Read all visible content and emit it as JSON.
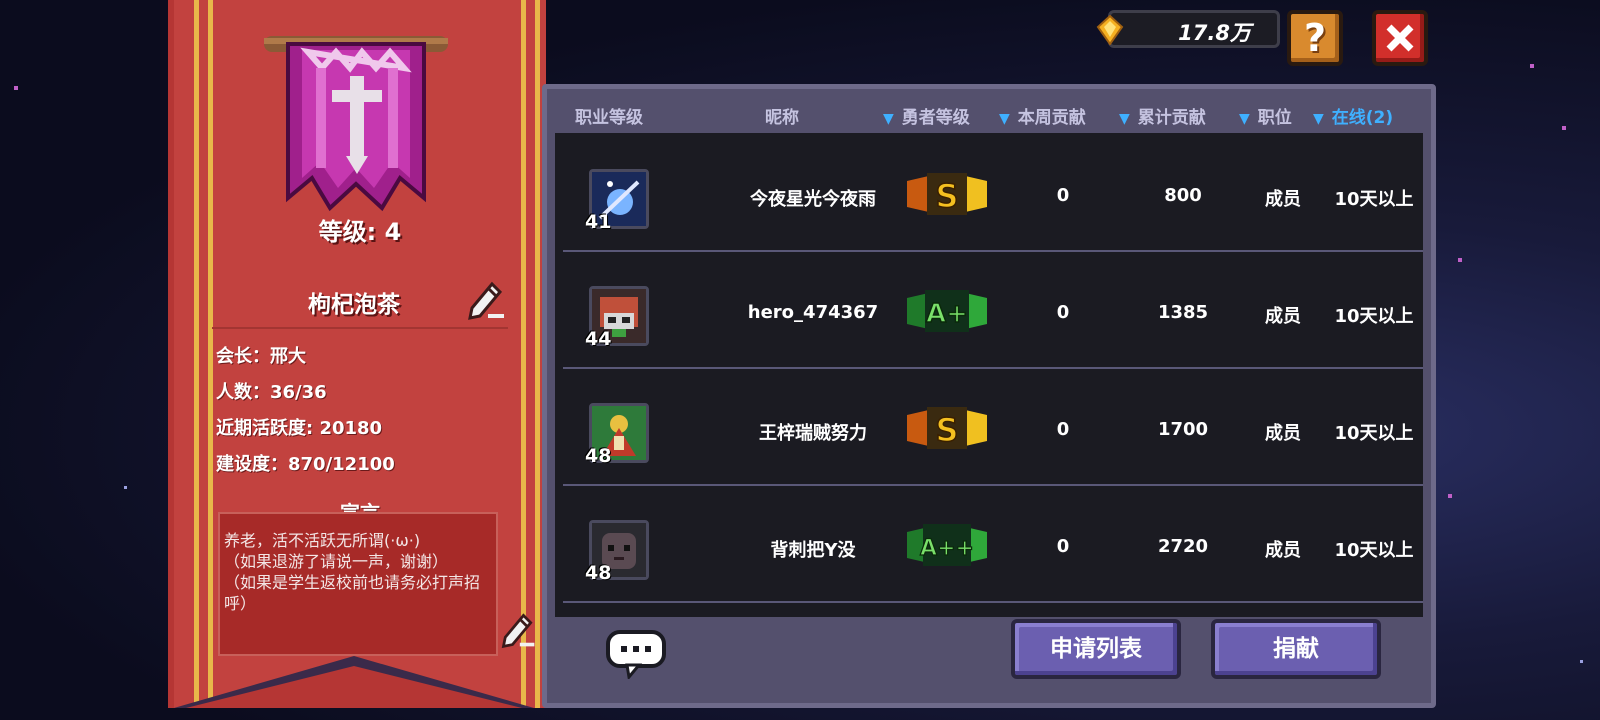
{
  "top_bar": {
    "gold_value": "17.8万",
    "help_label": "?"
  },
  "guild": {
    "level_label": "等级: 4",
    "name": "枸杞泡茶",
    "leader": "会长：邢大",
    "members": "人数：36/36",
    "activity": "近期活跃度: 20180",
    "construction": "建设度：870/12100",
    "declaration_title": "宣言",
    "declaration": "养老，活不活跃无所谓(·ω·)\n（如果退游了请说一声，谢谢）\n（如果是学生返校前也请务必打声招呼）"
  },
  "columns": {
    "class_level": "职业等级",
    "nickname": "昵称",
    "hero_level": "勇者等级",
    "weekly": "本周贡献",
    "total": "累计贡献",
    "position": "职位",
    "online": "在线(2)"
  },
  "members": [
    {
      "level": "41",
      "name": "今夜星光今夜雨",
      "rank": "S",
      "rank_color": "#f0a020",
      "weekly": "0",
      "total": "800",
      "position": "成员",
      "online": "10天以上"
    },
    {
      "level": "44",
      "name": "hero_474367",
      "rank": "A+",
      "rank_color": "#3ec03e",
      "weekly": "0",
      "total": "1385",
      "position": "成员",
      "online": "10天以上"
    },
    {
      "level": "48",
      "name": "王梓瑞贼努力",
      "rank": "S",
      "rank_color": "#f0a020",
      "weekly": "0",
      "total": "1700",
      "position": "成员",
      "online": "10天以上"
    },
    {
      "level": "48",
      "name": "背刺把Y没",
      "rank": "A++",
      "rank_color": "#3ec03e",
      "weekly": "0",
      "total": "2720",
      "position": "成员",
      "online": "10天以上"
    }
  ],
  "buttons": {
    "apply_list": "申请列表",
    "donate": "捐献"
  },
  "colors": {
    "banner_red": "#c2423f",
    "stripe_gold": "#e8b84a",
    "button_purple": "#6b5fb0",
    "close_red": "#d22f2b",
    "help_orange": "#d98a2e",
    "online_blue": "#3fb0ff"
  }
}
